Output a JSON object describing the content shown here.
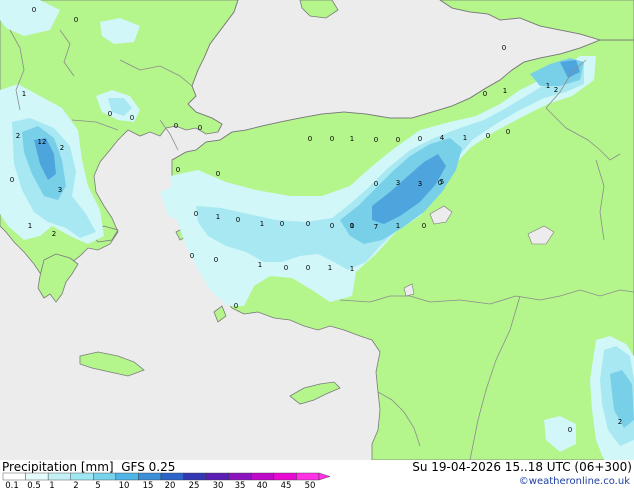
{
  "title": {
    "product": "Precipitation [mm]",
    "model": "GFS 0.25",
    "valid_time": "Su 19-04-2026 15..18 UTC (06+300)",
    "credit": "©weatheronline.co.uk"
  },
  "colors": {
    "sea": "#ececec",
    "land": "#b4f58c",
    "border": "#8c8c8c",
    "coast": "#7a7a7a",
    "precip_light": "#d2f7f8",
    "precip_mid": "#a8e8f2",
    "precip_heavy": "#78cfe8",
    "precip_max": "#4ea4dc"
  },
  "legend": {
    "labels": [
      "0.1",
      "0.5",
      "1",
      "2",
      "5",
      "10",
      "15",
      "20",
      "25",
      "30",
      "35",
      "40",
      "45",
      "50"
    ],
    "colors": [
      "#ffffff",
      "#e6fbfb",
      "#c3f0f5",
      "#9ee6f0",
      "#78d2ec",
      "#50b4e6",
      "#3a8fd6",
      "#2d64c8",
      "#3238b4",
      "#5a1eb4",
      "#8c14be",
      "#be0ac8",
      "#e60ad2",
      "#ff32e6"
    ]
  },
  "precip_values": [
    {
      "t": "0"
    },
    {
      "t": "0"
    },
    {
      "t": "0"
    },
    {
      "t": "0"
    },
    {
      "t": "2"
    },
    {
      "t": "1"
    },
    {
      "t": "0"
    },
    {
      "t": "1"
    },
    {
      "t": "2"
    },
    {
      "t": "12"
    },
    {
      "t": "2"
    },
    {
      "t": "0"
    },
    {
      "t": "3"
    },
    {
      "t": "1"
    },
    {
      "t": "1"
    },
    {
      "t": "2"
    },
    {
      "t": "0"
    },
    {
      "t": "0"
    },
    {
      "t": "0"
    },
    {
      "t": "0"
    },
    {
      "t": "0"
    },
    {
      "t": "0"
    },
    {
      "t": "0"
    },
    {
      "t": "1"
    },
    {
      "t": "0"
    },
    {
      "t": "0"
    },
    {
      "t": "0"
    },
    {
      "t": "3"
    },
    {
      "t": "4"
    },
    {
      "t": "1"
    },
    {
      "t": "0"
    },
    {
      "t": "0"
    },
    {
      "t": "0"
    },
    {
      "t": "0"
    },
    {
      "t": "3"
    },
    {
      "t": "5"
    },
    {
      "t": "0"
    },
    {
      "t": "0"
    },
    {
      "t": "1"
    },
    {
      "t": "0"
    },
    {
      "t": "1"
    },
    {
      "t": "0"
    },
    {
      "t": "0"
    },
    {
      "t": "0"
    },
    {
      "t": "1"
    },
    {
      "t": "7"
    },
    {
      "t": "1"
    },
    {
      "t": "0"
    },
    {
      "t": "0"
    },
    {
      "t": "0"
    },
    {
      "t": "1"
    },
    {
      "t": "0"
    },
    {
      "t": "0"
    },
    {
      "t": "1"
    },
    {
      "t": "1"
    },
    {
      "t": "0"
    },
    {
      "t": "0"
    },
    {
      "t": "2"
    }
  ]
}
